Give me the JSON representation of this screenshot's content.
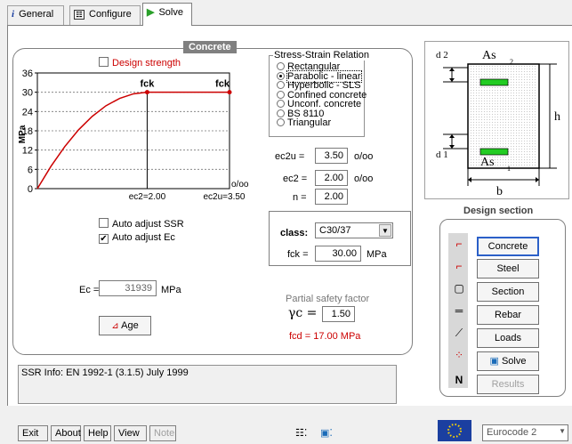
{
  "tabs": [
    {
      "label": "General",
      "icon": "info-icon"
    },
    {
      "label": "Configure",
      "icon": "configure-icon"
    },
    {
      "label": "Solve",
      "icon": "play-icon"
    }
  ],
  "concrete": {
    "title": "Concrete",
    "design_strength_label": "Design strength",
    "chart_data": {
      "type": "line",
      "ylabel": "MPa",
      "ylim": [
        0,
        36
      ],
      "yticks": [
        "0",
        "6",
        "12",
        "18",
        "24",
        "30",
        "36"
      ],
      "fck_labels": [
        "fck",
        "fck"
      ],
      "x_markers": [
        "ec2=2.00",
        "ec2u=3.50"
      ],
      "x_unit": "o/oo",
      "xlim": [
        0,
        3.5
      ],
      "series": [
        {
          "x": [
            0,
            0.25,
            0.5,
            0.75,
            1.0,
            1.25,
            1.5,
            1.75,
            2.0,
            2.75,
            3.5
          ],
          "y": [
            0,
            7.0,
            13.1,
            18.3,
            22.5,
            25.8,
            28.1,
            29.5,
            30.0,
            30.0,
            30.0
          ]
        }
      ],
      "grid": true
    },
    "ssr": {
      "title": "Stress-Strain Relation",
      "options": [
        "Rectangular",
        "Parabolic - linear",
        "Hyperbolic - SLS",
        "Confined concrete",
        "Unconf. concrete",
        "BS 8110",
        "Triangular"
      ],
      "selected_index": 1
    },
    "ec2u_label": "ec2u =",
    "ec2u_value": "3.50",
    "ec2u_unit": "o/oo",
    "ec2_label": "ec2 =",
    "ec2_value": "2.00",
    "ec2_unit": "o/oo",
    "n_label": "n =",
    "n_value": "2.00",
    "auto_ssr_label": "Auto adjust  SSR",
    "auto_ssr_checked": false,
    "auto_ec_label": "Auto adjust  Ec",
    "auto_ec_checked": true,
    "ec_label": "Ec =",
    "ec_value": "31939",
    "ec_unit": "MPa",
    "age_button": "Age",
    "class_label": "class:",
    "class_value": "C30/37",
    "fck_label": "fck =",
    "fck_value": "30.00",
    "fck_unit": "MPa",
    "psf_label": "Partial safety factor",
    "gamma_label": "γc =",
    "gamma_value": "1.50",
    "fcd_text": "fcd = 17.00 MPa"
  },
  "section_diagram": {
    "d2": "d 2",
    "as_top": "As",
    "as_top_sub": "2",
    "h": "h",
    "d1": "d 1",
    "as_bot": "As",
    "as_bot_sub": "1",
    "b": "b"
  },
  "design_section": {
    "title": "Design section",
    "buttons": [
      "Concrete",
      "Steel",
      "Section",
      "Rebar",
      "Loads",
      "Solve",
      "Results"
    ],
    "icons": [
      "stress-curve-icon",
      "steel-curve-icon",
      "section-icon",
      "rebar-icon",
      "loads-icon",
      "dots-icon",
      "n-icon"
    ]
  },
  "ssr_info": "SSR Info:  EN 1992-1 (3.1.5) July 1999",
  "bottom": {
    "buttons": [
      "Exit",
      "About",
      "Help",
      "View",
      "Note"
    ],
    "code_value": "Eurocode 2"
  },
  "colors": {
    "accent_red": "#cc0000",
    "green_bar": "#22cc22"
  }
}
